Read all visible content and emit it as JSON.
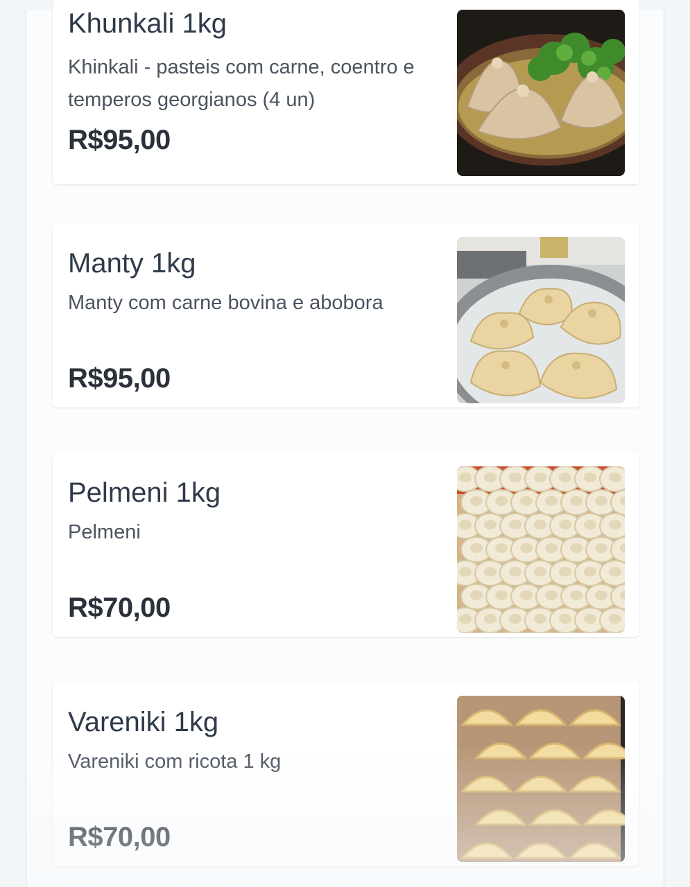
{
  "menu": {
    "items": [
      {
        "name": "Khunkali 1kg",
        "description": "Khinkali - pasteis com carne, coentro e temperos georgianos (4 un)",
        "price": "R$95,00",
        "image": "khinkali-photo"
      },
      {
        "name": "Manty 1kg",
        "description": "Manty com carne bovina e abobora",
        "price": "R$95,00",
        "image": "manty-photo"
      },
      {
        "name": "Pelmeni 1kg",
        "description": "Pelmeni",
        "price": "R$70,00",
        "image": "pelmeni-photo"
      },
      {
        "name": "Vareniki 1kg",
        "description": "Vareniki com ricota 1 kg",
        "price": "R$70,00",
        "image": "vareniki-photo"
      }
    ]
  },
  "colors": {
    "background": "#f3f6f9",
    "card": "#ffffff",
    "title": "#2f3a4a",
    "price": "#2b313a"
  }
}
